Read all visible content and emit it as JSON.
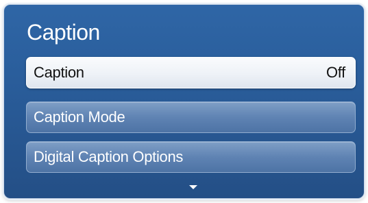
{
  "menu": {
    "title": "Caption",
    "items": [
      {
        "label": "Caption",
        "value": "Off"
      },
      {
        "label": "Caption Mode"
      },
      {
        "label": "Digital Caption Options"
      }
    ],
    "more_indicator_icon": "triangle-down-icon"
  },
  "colors": {
    "panel": "#2a5e9c",
    "selected_item": "#eef2f7",
    "normal_item": "#5f83b3",
    "text_light": "#ffffff",
    "text_dark": "#111111"
  }
}
